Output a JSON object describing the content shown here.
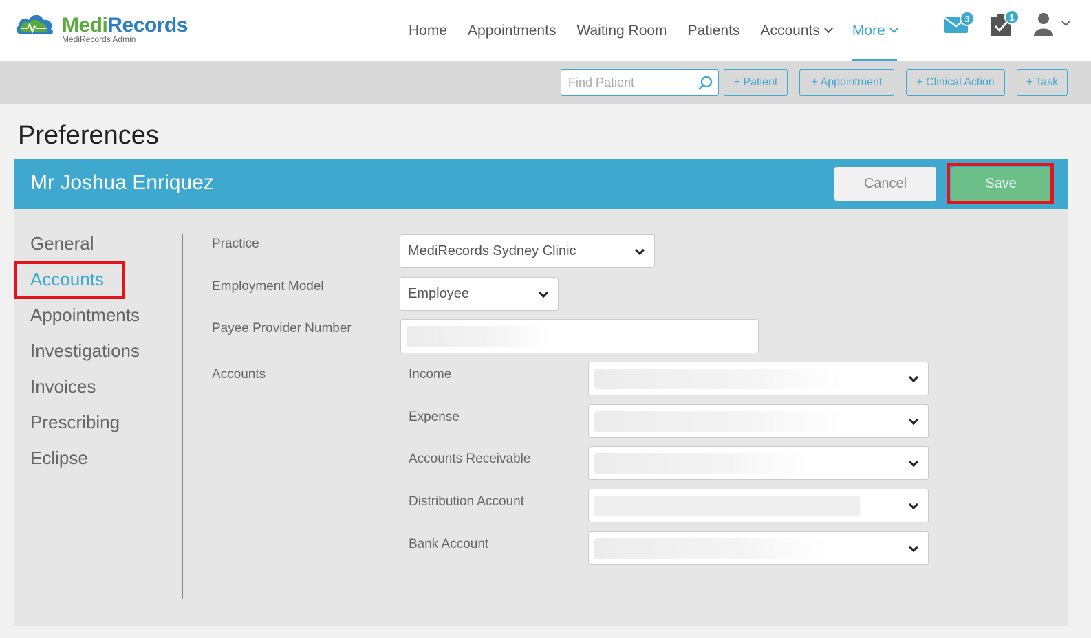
{
  "brand": {
    "name_part1": "Medi",
    "name_part2": "Records",
    "subtitle": "MediRecords Admin"
  },
  "nav": {
    "items": [
      {
        "label": "Home",
        "dropdown": false,
        "active": false
      },
      {
        "label": "Appointments",
        "dropdown": false,
        "active": false
      },
      {
        "label": "Waiting Room",
        "dropdown": false,
        "active": false
      },
      {
        "label": "Patients",
        "dropdown": false,
        "active": false
      },
      {
        "label": "Accounts",
        "dropdown": true,
        "active": false
      },
      {
        "label": "More",
        "dropdown": true,
        "active": true
      }
    ],
    "messages_badge": "3",
    "tasks_badge": "1"
  },
  "toolbar": {
    "search_placeholder": "Find Patient",
    "add_patient": "+ Patient",
    "add_appointment": "+ Appointment",
    "add_clinical_action": "+ Clinical Action",
    "add_task": "+ Task"
  },
  "page": {
    "title": "Preferences"
  },
  "panel": {
    "user_name": "Mr Joshua Enriquez",
    "cancel_label": "Cancel",
    "save_label": "Save"
  },
  "sidebar": {
    "items": [
      "General",
      "Accounts",
      "Appointments",
      "Investigations",
      "Invoices",
      "Prescribing",
      "Eclipse"
    ],
    "active": "Accounts"
  },
  "form": {
    "practice_label": "Practice",
    "practice_value": "MediRecords Sydney Clinic",
    "employment_label": "Employment Model",
    "employment_value": "Employee",
    "payee_label": "Payee Provider Number",
    "accounts_label": "Accounts",
    "income_label": "Income",
    "expense_label": "Expense",
    "receivable_label": "Accounts Receivable",
    "distribution_label": "Distribution Account",
    "bank_label": "Bank Account"
  },
  "colors": {
    "accent": "#3fa8cf",
    "save": "#6cbf88",
    "highlight": "#e3141b"
  }
}
